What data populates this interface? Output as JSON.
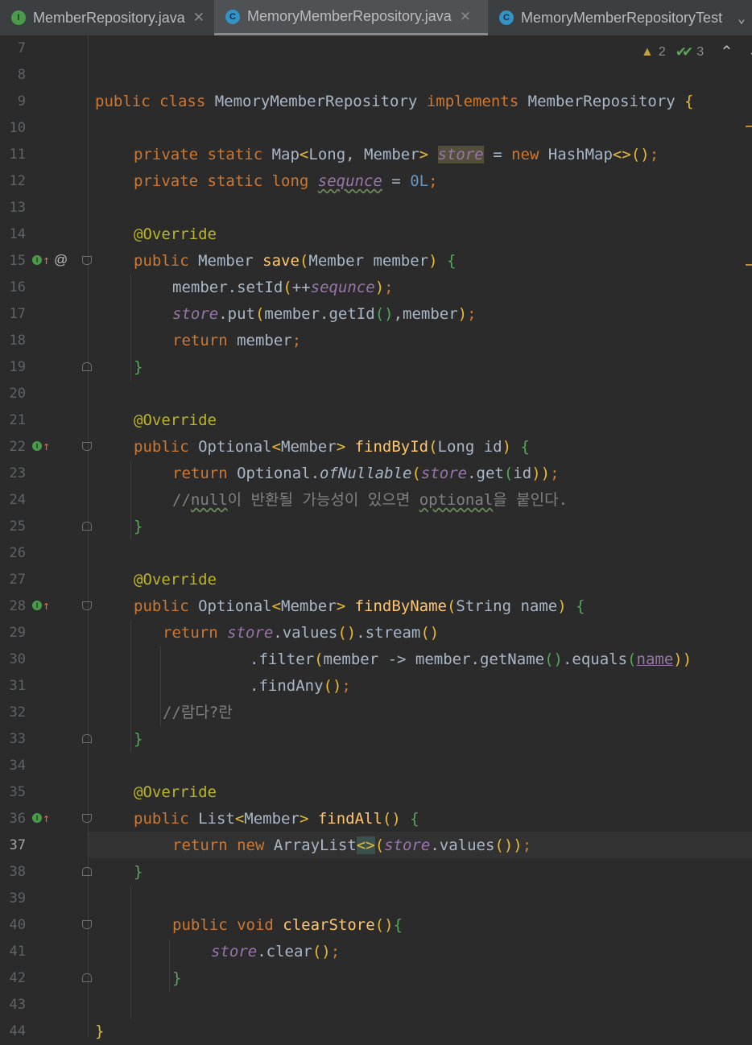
{
  "tabs": [
    {
      "label": "MemberRepository.java",
      "icon": "interface-icon",
      "icon_letter": "I",
      "close": "✕",
      "active": false
    },
    {
      "label": "MemoryMemberRepository.java",
      "icon": "class-icon",
      "icon_letter": "C",
      "close": "✕",
      "active": true
    },
    {
      "label": "MemoryMemberRepositoryTest",
      "icon": "test-class-icon",
      "icon_letter": "C",
      "active": false
    }
  ],
  "tab_menu": "⌄",
  "inspection": {
    "warnings": "2",
    "weak_warnings": "3",
    "warning_icon": "▲",
    "weak_icon": "✔✔",
    "up": "⌃",
    "down": "⌄"
  },
  "gutter": {
    "at_symbol": "@",
    "impl_letter": "I",
    "impl_arrow": "↑"
  },
  "editor": {
    "active_line": "37",
    "line_numbers": [
      "7",
      "8",
      "9",
      "10",
      "11",
      "12",
      "13",
      "14",
      "15",
      "16",
      "17",
      "18",
      "19",
      "20",
      "21",
      "22",
      "23",
      "24",
      "25",
      "26",
      "27",
      "28",
      "29",
      "30",
      "31",
      "32",
      "33",
      "34",
      "35",
      "36",
      "37",
      "38",
      "39",
      "40",
      "41",
      "42",
      "43",
      "44"
    ],
    "code": {
      "l9": [
        "public class ",
        "MemoryMemberRepository ",
        "implements ",
        "MemberRepository ",
        "{"
      ],
      "l11": [
        "private static ",
        "Map",
        "<",
        "Long, Member",
        "> ",
        "store",
        " = ",
        "new ",
        "HashMap",
        "<>",
        "()",
        ";"
      ],
      "l12": [
        "private static long ",
        "sequnce",
        " = ",
        "0L",
        ";"
      ],
      "l14": "@Override",
      "l15": [
        "public ",
        "Member ",
        "save",
        "(",
        "Member member",
        ") ",
        "{"
      ],
      "l16": [
        "member.setId",
        "(",
        "++",
        "sequnce",
        ")",
        ";"
      ],
      "l17": [
        "store",
        ".put",
        "(",
        "member.getId",
        "()",
        ",member",
        ")",
        ";"
      ],
      "l18": [
        "return ",
        "member",
        ";"
      ],
      "l19": "}",
      "l21": "@Override",
      "l22": [
        "public ",
        "Optional",
        "<",
        "Member",
        "> ",
        "findById",
        "(",
        "Long id",
        ") ",
        "{"
      ],
      "l23": [
        "return ",
        "Optional.",
        "ofNullable",
        "(",
        "store",
        ".get",
        "(",
        "id",
        "))",
        ";"
      ],
      "l24": [
        "//",
        "null",
        "이 반환될 가능성이 있으면 ",
        "optional",
        "을 붙인다."
      ],
      "l25": "}",
      "l27": "@Override",
      "l28": [
        "public ",
        "Optional",
        "<",
        "Member",
        "> ",
        "findByName",
        "(",
        "String name",
        ") ",
        "{"
      ],
      "l29": [
        "return ",
        "store",
        ".values",
        "()",
        ".stream",
        "()"
      ],
      "l30": [
        ".filter",
        "(",
        "member -> member.getName",
        "()",
        ".equals",
        "(",
        "name",
        "))"
      ],
      "l31": [
        ".findAny",
        "()",
        ";"
      ],
      "l32": "//람다?란",
      "l33": "}",
      "l35": "@Override",
      "l36": [
        "public ",
        "List",
        "<",
        "Member",
        "> ",
        "findAll",
        "() ",
        "{"
      ],
      "l37": [
        "return new ",
        "ArrayList",
        "<>",
        "(",
        "store",
        ".values",
        "())",
        ";"
      ],
      "l38": "}",
      "l40": [
        "public void ",
        "clearStore",
        "()",
        "{"
      ],
      "l41": [
        "store",
        ".clear",
        "()",
        ";"
      ],
      "l42": "}",
      "l44": "}"
    }
  },
  "colors": {
    "background": "#2b2b2b",
    "keyword": "#cc7832",
    "method": "#ffc66d",
    "static_field": "#9876aa",
    "number": "#6897bb",
    "annotation": "#bbb529",
    "comment": "#808080",
    "text": "#a9b7c6"
  }
}
